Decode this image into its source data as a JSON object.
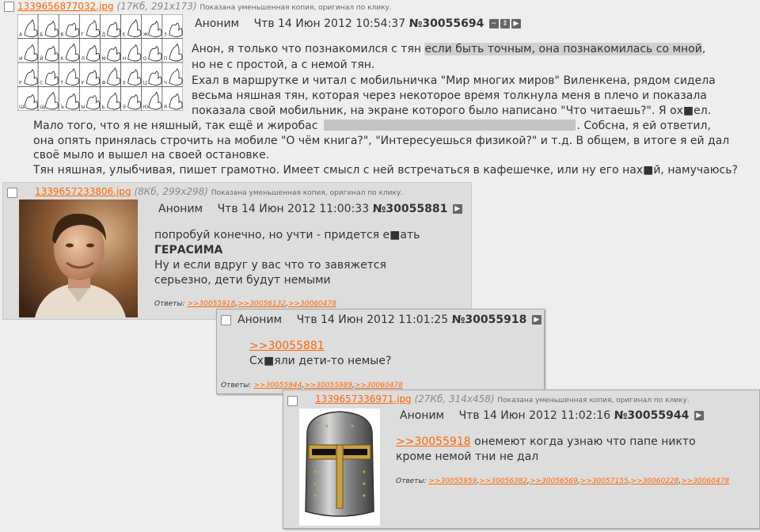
{
  "op": {
    "file_name": "1339656877032.jpg",
    "file_meta": "(17Кб, 291x173)",
    "file_note": "Показана уменьшенная копия, оригинал по клику.",
    "author": "Аноним",
    "date": "Чтв 14 Июн 2012 10:54:37",
    "post_number": "№30055694",
    "text": {
      "l1a": "Анон, я только что познакомился с тян ",
      "l1b": "если быть точным, она познакомилась со мной",
      "l1c": ",",
      "l2": "но не с простой, а с немой тян.",
      "l3": "Ехал в маршрутке и читал с мобильничка \"Мир многих миров\" Виленкена, рядом сидела",
      "l4": "весьма няшная тян, которая через некоторое время толкнула меня в плечо и показала",
      "l5": "показала свой мобильник, на экране которого было написано \"Что читаешь?\". Я ох■ел.",
      "l6a": "Мало того, что я не няшный, так ещё и жиробас",
      "l6b": ". Собсна, я ей ответил,",
      "l7": "она опять принялась строчить на мобиле \"О чём книга?\", \"Интересуешься физикой?\" и т.д. В общем, в итоге я ей дал",
      "l8": "своё мыло и вышел на своей остановке.",
      "l9": "Тян няшная, улыбчивая, пишет грамотно. Имеет смысл с ней встречаться в кафешечке, или ну его нах■й, намучаюсь?"
    }
  },
  "replies": [
    {
      "file_name": "1339657233806.jpg",
      "file_meta": "(8Кб, 299x298)",
      "file_note": "Показана уменьшенная копия, оригинал по клику.",
      "author": "Аноним",
      "date": "Чтв 14 Июн 2012 11:00:33",
      "post_number": "№30055881",
      "text": {
        "l1": "попробуй конечно, но учти - придется е■ать",
        "l2": "ГЕРАСИМА",
        "l3": "Ну и если вдруг у вас что то завяжется",
        "l4": "серьезно, дети будут немыми"
      },
      "refs_label": "Ответы:",
      "refs": [
        ">>30055918",
        ">>30056132",
        ">>30060478"
      ]
    },
    {
      "author": "Аноним",
      "date": "Чтв 14 Июн 2012 11:01:25",
      "post_number": "№30055918",
      "text": {
        "quote": ">>30055881",
        "l1": "Сх■яли дети-то немые?"
      },
      "refs_label": "Ответы:",
      "refs": [
        ">>30055944",
        ">>30055989",
        ">>30060478"
      ]
    },
    {
      "file_name": "1339657336971.jpg",
      "file_meta": "(27Кб, 314x458)",
      "file_note": "Показана уменьшенная копия, оригинал по клику.",
      "author": "Аноним",
      "date": "Чтв 14 Июн 2012 11:02:16",
      "post_number": "№30055944",
      "text": {
        "quote": ">>30055918",
        "l1": " онемеют когда узнаю что папе никто",
        "l2": "кроме немой тни не дал"
      },
      "refs_label": "Ответы:",
      "refs": [
        ">>30055959",
        ">>30056382",
        ">>30056569",
        ">>30057155",
        ">>30060228",
        ">>30060478"
      ]
    }
  ],
  "icons": {
    "hide": "minus-icon",
    "expand": "expand-icon",
    "reply": "play-icon"
  },
  "sign_alphabet_letters": [
    "А",
    "Б",
    "В",
    "Г",
    "Д",
    "Е",
    "Ж",
    "З",
    "И",
    "Й",
    "К",
    "Л",
    "М",
    "Н",
    "О",
    "П",
    "Р",
    "С",
    "Т",
    "У",
    "Ф",
    "Х",
    "Ц",
    "Ч",
    "Ш",
    "Щ",
    "Ъ",
    "Ы",
    "Ь",
    "Э",
    "Ю",
    "Я"
  ],
  "colors": {
    "link": "#ff6600",
    "background": "#eeeeee",
    "reply_bg": "#dddddd",
    "redaction": "#c4c4c4"
  }
}
